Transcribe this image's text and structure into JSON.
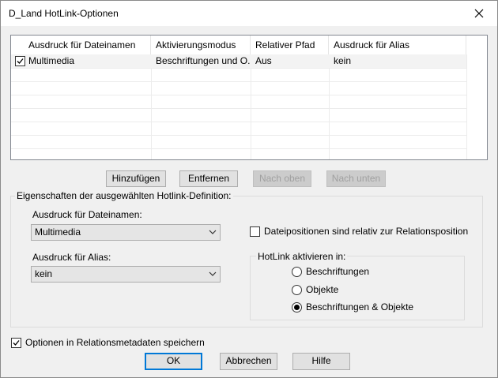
{
  "window": {
    "title": "D_Land HotLink-Optionen"
  },
  "list": {
    "columns": [
      "Ausdruck für Dateinamen",
      "Aktivierungsmodus",
      "Relativer Pfad",
      "Ausdruck für Alias"
    ],
    "rows": [
      {
        "checked": true,
        "cells": [
          "Multimedia",
          "Beschriftungen und O...",
          "Aus",
          "kein"
        ]
      }
    ]
  },
  "list_buttons": {
    "add": "Hinzufügen",
    "remove": "Entfernen",
    "up": "Nach oben",
    "down": "Nach unten"
  },
  "properties": {
    "group_label": "Eigenschaften der ausgewählten Hotlink-Definition:",
    "filename_label": "Ausdruck für Dateinamen:",
    "filename_value": "Multimedia",
    "alias_label": "Ausdruck für Alias:",
    "alias_value": "kein",
    "relative_checkbox_label": "Dateipositionen sind relativ zur Relationsposition",
    "relative_checked": false,
    "activate_group_label": "HotLink aktivieren in:",
    "activate_options": [
      "Beschriftungen",
      "Objekte",
      "Beschriftungen & Objekte"
    ],
    "activate_selected": "Beschriftungen & Objekte"
  },
  "save_option": {
    "label": "Optionen in Relationsmetadaten speichern",
    "checked": true
  },
  "footer": {
    "ok": "OK",
    "cancel": "Abbrechen",
    "help": "Hilfe"
  }
}
